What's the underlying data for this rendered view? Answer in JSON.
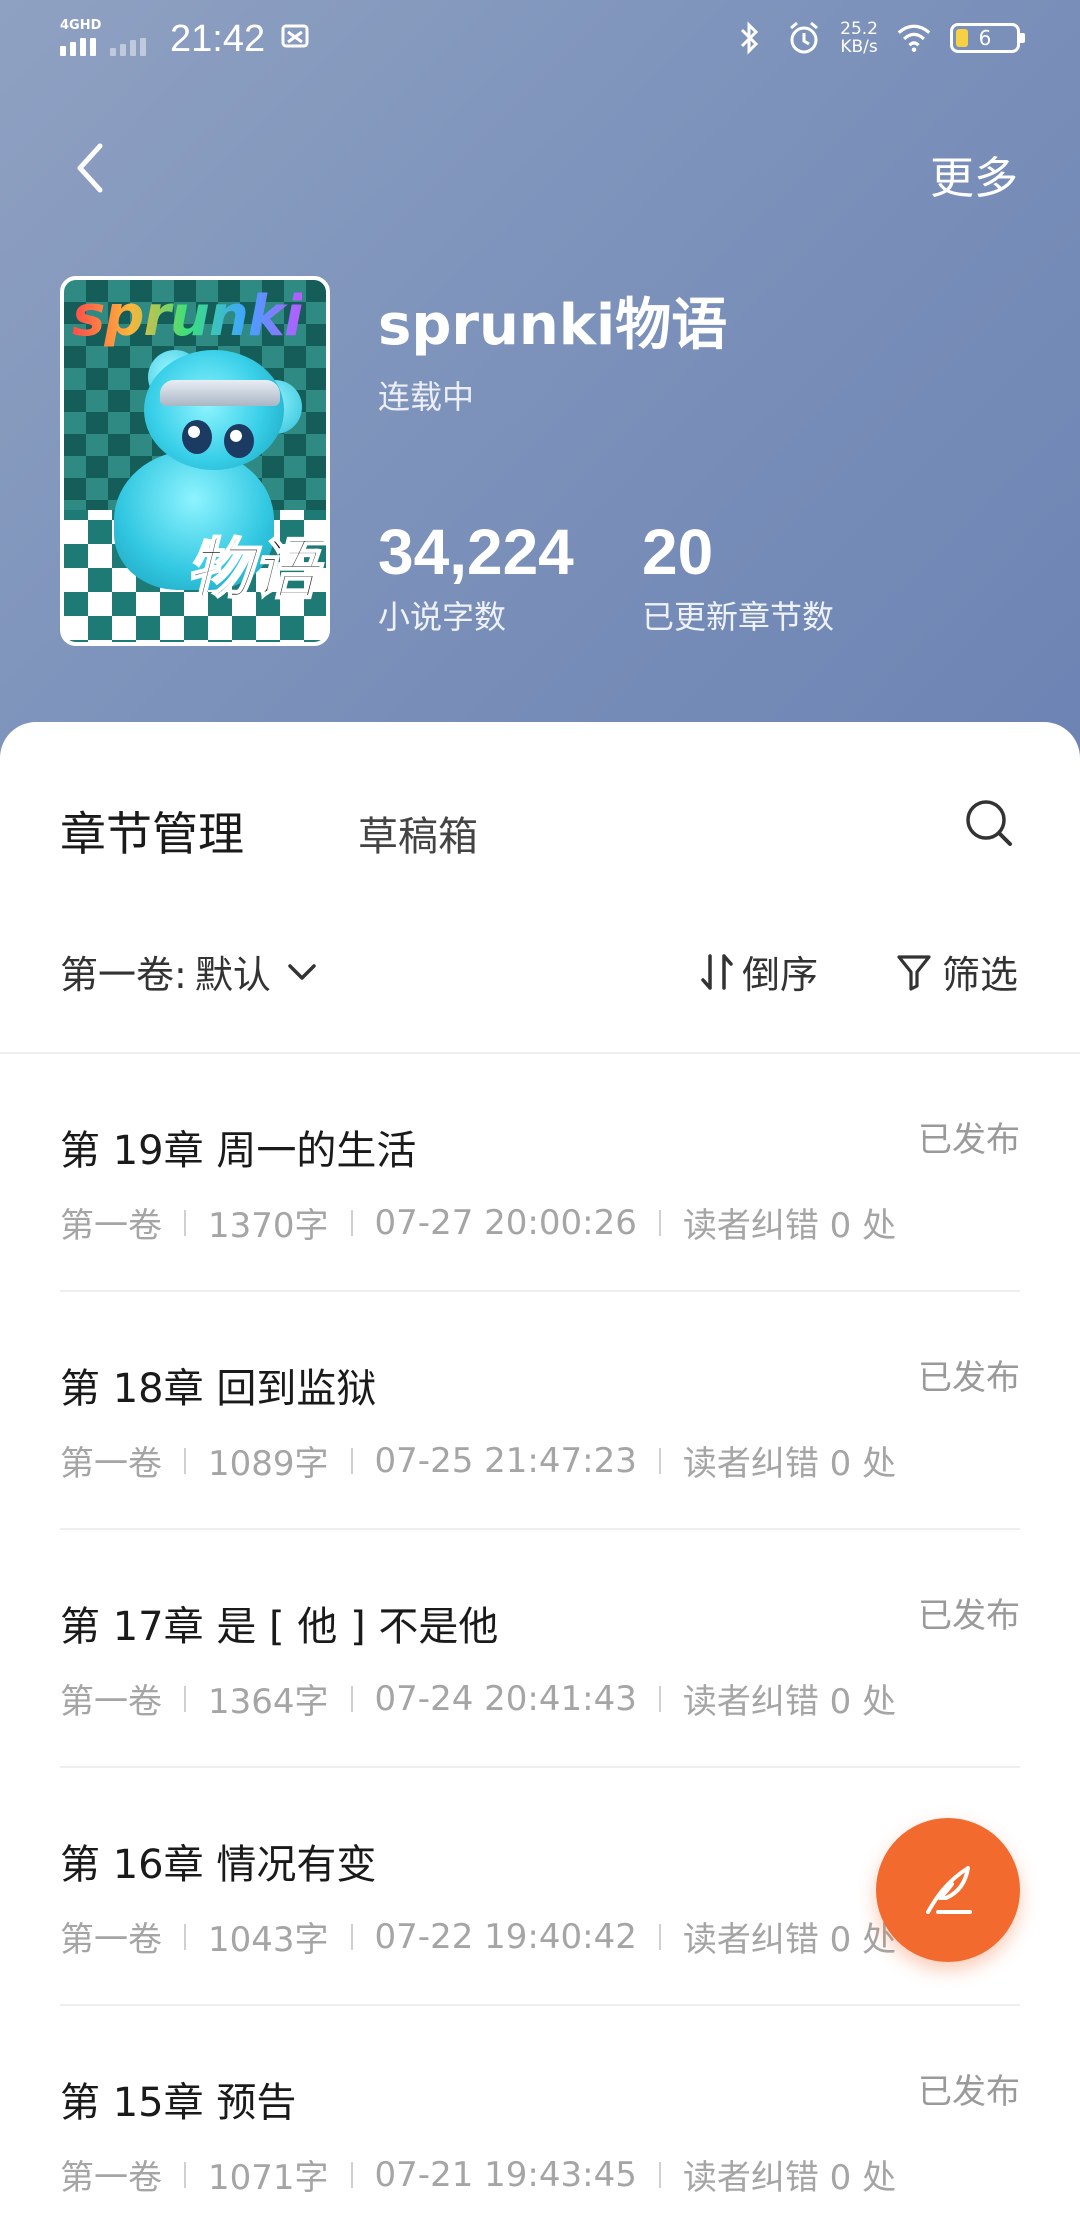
{
  "status_bar": {
    "network": "4GHD",
    "time": "21:42",
    "speed_value": "25.2",
    "speed_unit": "KB/s",
    "battery": "6"
  },
  "nav": {
    "more_label": "更多"
  },
  "book": {
    "cover_logo": "sprunki",
    "cover_title": "物语",
    "title": "sprunki物语",
    "status": "连载中",
    "word_count": "34,224",
    "word_count_label": "小说字数",
    "chapter_count": "20",
    "chapter_count_label": "已更新章节数"
  },
  "tabs": {
    "active": "章节管理",
    "drafts": "草稿箱"
  },
  "toolbar": {
    "volume_label": "第一卷:",
    "volume_value": "默认",
    "sort_label": "倒序",
    "filter_label": "筛选"
  },
  "chapters": [
    {
      "title": "第 19章 周一的生活",
      "status": "已发布",
      "volume": "第一卷",
      "words": "1370字",
      "time": "07-27 20:00:26",
      "errata": "读者纠错 0 处"
    },
    {
      "title": "第 18章 回到监狱",
      "status": "已发布",
      "volume": "第一卷",
      "words": "1089字",
      "time": "07-25 21:47:23",
      "errata": "读者纠错 0 处"
    },
    {
      "title": "第 17章 是 [ 他 ] 不是他",
      "status": "已发布",
      "volume": "第一卷",
      "words": "1364字",
      "time": "07-24 20:41:43",
      "errata": "读者纠错 0 处"
    },
    {
      "title": "第 16章 情况有变",
      "status": "",
      "volume": "第一卷",
      "words": "1043字",
      "time": "07-22 19:40:42",
      "errata": "读者纠错 0 处"
    },
    {
      "title": "第 15章 预告",
      "status": "已发布",
      "volume": "第一卷",
      "words": "1071字",
      "time": "07-21 19:43:45",
      "errata": "读者纠错 0 处"
    }
  ],
  "colors": {
    "header_gradient_start": "#8fa1c2",
    "header_gradient_end": "#6d83b3",
    "fab": "#f26a2e",
    "muted_text": "#a5a5a5"
  },
  "icons": {
    "back": "chevron-left-icon",
    "search": "search-icon",
    "volume_dropdown": "chevron-down-icon",
    "sort": "sort-arrows-icon",
    "filter": "filter-funnel-icon",
    "fab": "quill-write-icon",
    "bluetooth": "bluetooth-icon",
    "alarm": "alarm-icon",
    "wifi": "wifi-icon"
  }
}
